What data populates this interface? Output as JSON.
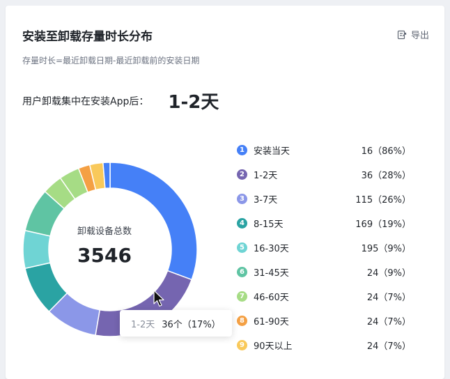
{
  "card": {
    "title": "安装至卸载存量时长分布",
    "export_label": "导出",
    "subtitle": "存量时长=最近卸载日期-最近卸载前的安装日期",
    "summary_label": "用户卸载集中在安装App后：",
    "summary_value": "1-2天"
  },
  "chart_data": {
    "type": "pie",
    "donut": true,
    "center_label": "卸载设备总数",
    "center_value": "3546",
    "categories": [
      "安装当天",
      "1-2天",
      "3-7天",
      "8-15天",
      "16-30天",
      "31-45天",
      "46-60天",
      "61-90天",
      "90天以上"
    ],
    "values": [
      16,
      36,
      115,
      169,
      195,
      24,
      24,
      24,
      24
    ],
    "value_labels": [
      "16（86%）",
      "36（28%）",
      "115（26%）",
      "169（19%）",
      "195（9%）",
      "24（9%）",
      "24（7%）",
      "24（7%）",
      "24（7%）"
    ],
    "slice_shares": [
      0.285,
      0.205,
      0.09,
      0.085,
      0.065,
      0.075,
      0.035,
      0.035,
      0.02,
      0.023,
      0.012
    ],
    "slice_colors": [
      "#4580f7",
      "#7565b0",
      "#8b97e8",
      "#2aa3a3",
      "#6fd4d4",
      "#5fc4a3",
      "#a6dc85",
      "#a6dc85",
      "#f4a044",
      "#f9c95b",
      "#4580f7"
    ],
    "legend_colors": [
      "#4580f7",
      "#7565b0",
      "#8b97e8",
      "#2aa3a3",
      "#6fd4d4",
      "#5fc4a3",
      "#a6dc85",
      "#f4a044",
      "#f9c95b"
    ],
    "legend_placement": "right",
    "tooltip": {
      "label": "1-2天",
      "value": "36个（17%）"
    }
  }
}
